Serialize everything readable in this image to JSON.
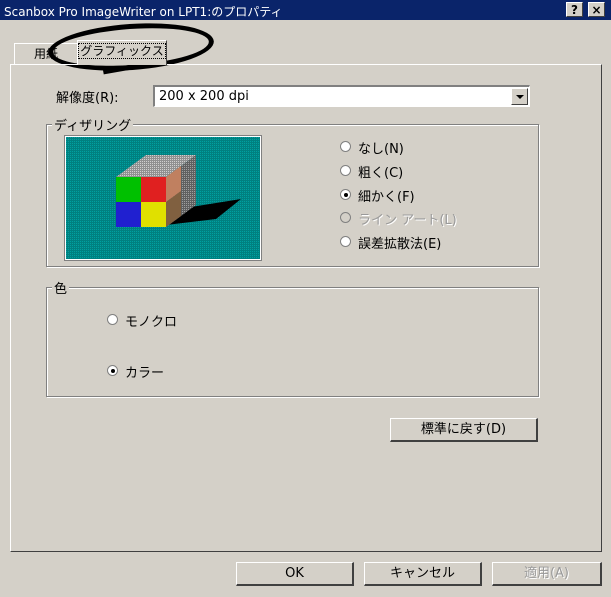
{
  "window": {
    "title": "Scanbox Pro ImageWriter on LPT1:のプロパティ",
    "help_button": "?",
    "close_button": "×"
  },
  "tabs": [
    {
      "label": "用紙"
    },
    {
      "label": "グラフィックス"
    }
  ],
  "resolution": {
    "label": "解像度(R):",
    "value": "200 x 200 dpi"
  },
  "dithering": {
    "group_label": "ディザリング",
    "options": [
      {
        "label": "なし(N)",
        "selected": false,
        "enabled": true
      },
      {
        "label": "粗く(C)",
        "selected": false,
        "enabled": true
      },
      {
        "label": "細かく(F)",
        "selected": true,
        "enabled": true
      },
      {
        "label": "ライン アート(L)",
        "selected": false,
        "enabled": false
      },
      {
        "label": "誤差拡散法(E)",
        "selected": false,
        "enabled": true
      }
    ]
  },
  "color": {
    "group_label": "色",
    "options": [
      {
        "label": "モノクロ",
        "selected": false
      },
      {
        "label": "カラー",
        "selected": true
      }
    ]
  },
  "buttons": {
    "restore_defaults": "標準に戻す(D)",
    "ok": "OK",
    "cancel": "キャンセル",
    "apply": "適用(A)"
  }
}
